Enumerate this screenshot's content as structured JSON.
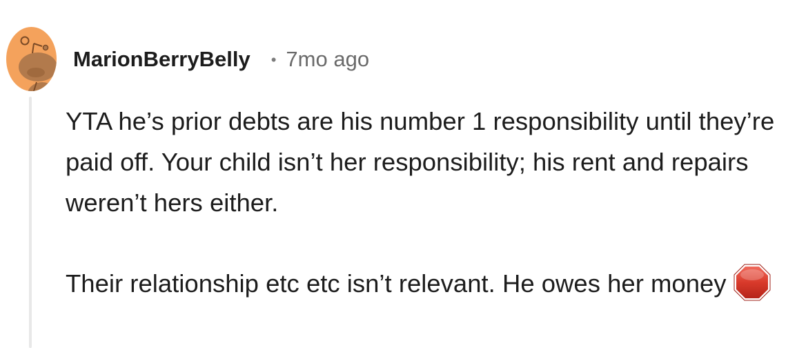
{
  "comment": {
    "username": "MarionBerryBelly",
    "separator": "•",
    "timestamp": "7mo ago",
    "paragraphs": [
      "YTA he’s prior debts are his number 1 responsibility until they’re paid off. Your child isn’t her responsibility; his rent and repairs weren’t hers either.",
      "Their relationship etc etc isn’t relevant. He owes her money"
    ],
    "trailing_emoji": "stop-sign-emoji"
  },
  "avatar": {
    "icon": "snoo-avatar-icon",
    "background_color": "#F4A25C",
    "snoo_color": "#B27A4C"
  },
  "colors": {
    "text": "#1C1C1C",
    "meta": "#6A6A6A",
    "thread_line": "#E8E8E8",
    "stop_sign": "#D93A2B"
  }
}
